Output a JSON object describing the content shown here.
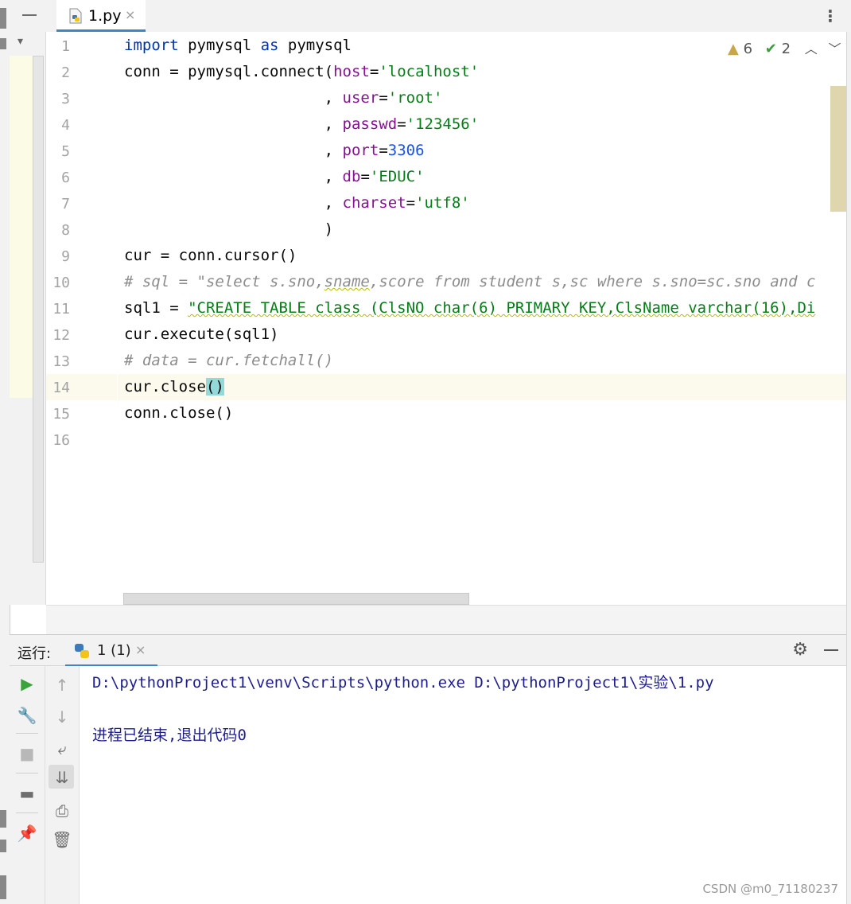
{
  "editor": {
    "tab": {
      "label": "1.py",
      "close": "×"
    },
    "more_menu": "⋮",
    "inspections": {
      "warnings": "6",
      "typos": "2"
    },
    "line_numbers": [
      "1",
      "2",
      "3",
      "4",
      "5",
      "6",
      "7",
      "8",
      "9",
      "10",
      "11",
      "12",
      "13",
      "14",
      "15",
      "16"
    ],
    "lines": {
      "l1": {
        "import": "import",
        "mod": " pymysql ",
        "as": "as",
        "alias": " pymysql"
      },
      "l2": {
        "a": "conn = pymysql.connect(",
        "kw": "host",
        "eq": "=",
        "val": "'localhost'"
      },
      "l3": {
        "a": "                      , ",
        "kw": "user",
        "eq": "=",
        "val": "'root'"
      },
      "l4": {
        "a": "                      , ",
        "kw": "passwd",
        "eq": "=",
        "val": "'123456'"
      },
      "l5": {
        "a": "                      , ",
        "kw": "port",
        "eq": "=",
        "val": "3306"
      },
      "l6": {
        "a": "                      , ",
        "kw": "db",
        "eq": "=",
        "val": "'EDUC'"
      },
      "l7": {
        "a": "                      , ",
        "kw": "charset",
        "eq": "=",
        "val": "'utf8'"
      },
      "l8": "                      )",
      "l9": "cur = conn.cursor()",
      "l10a": "# sql = \"select s.sno,",
      "l10b": "sname",
      "l10c": ",score from student s,sc where s.sno=sc.sno and c",
      "l11a": "sql1 = ",
      "l11b": "\"CREATE TABLE class (ClsNO char(6) PRIMARY KEY,ClsName varchar(16),Di",
      "l12": "cur.execute(sql1)",
      "l13": "# data = cur.fetchall()",
      "l14a": "cur.close",
      "l14b": "()",
      "l15": "conn.close()"
    }
  },
  "run_panel": {
    "title": "运行:",
    "tab_label": "1 (1)",
    "tab_close": "×",
    "console": [
      "D:\\pythonProject1\\venv\\Scripts\\python.exe D:\\pythonProject1\\实验\\1.py",
      "进程已结束,退出代码0"
    ]
  },
  "watermark": "CSDN @m0_71180237",
  "colors": {
    "keyword": "#0033b3",
    "param": "#871094",
    "string": "#067d17",
    "number": "#1750eb",
    "comment": "#8c8c8c",
    "console_text": "#1d1d90",
    "accent": "#4083c9"
  }
}
